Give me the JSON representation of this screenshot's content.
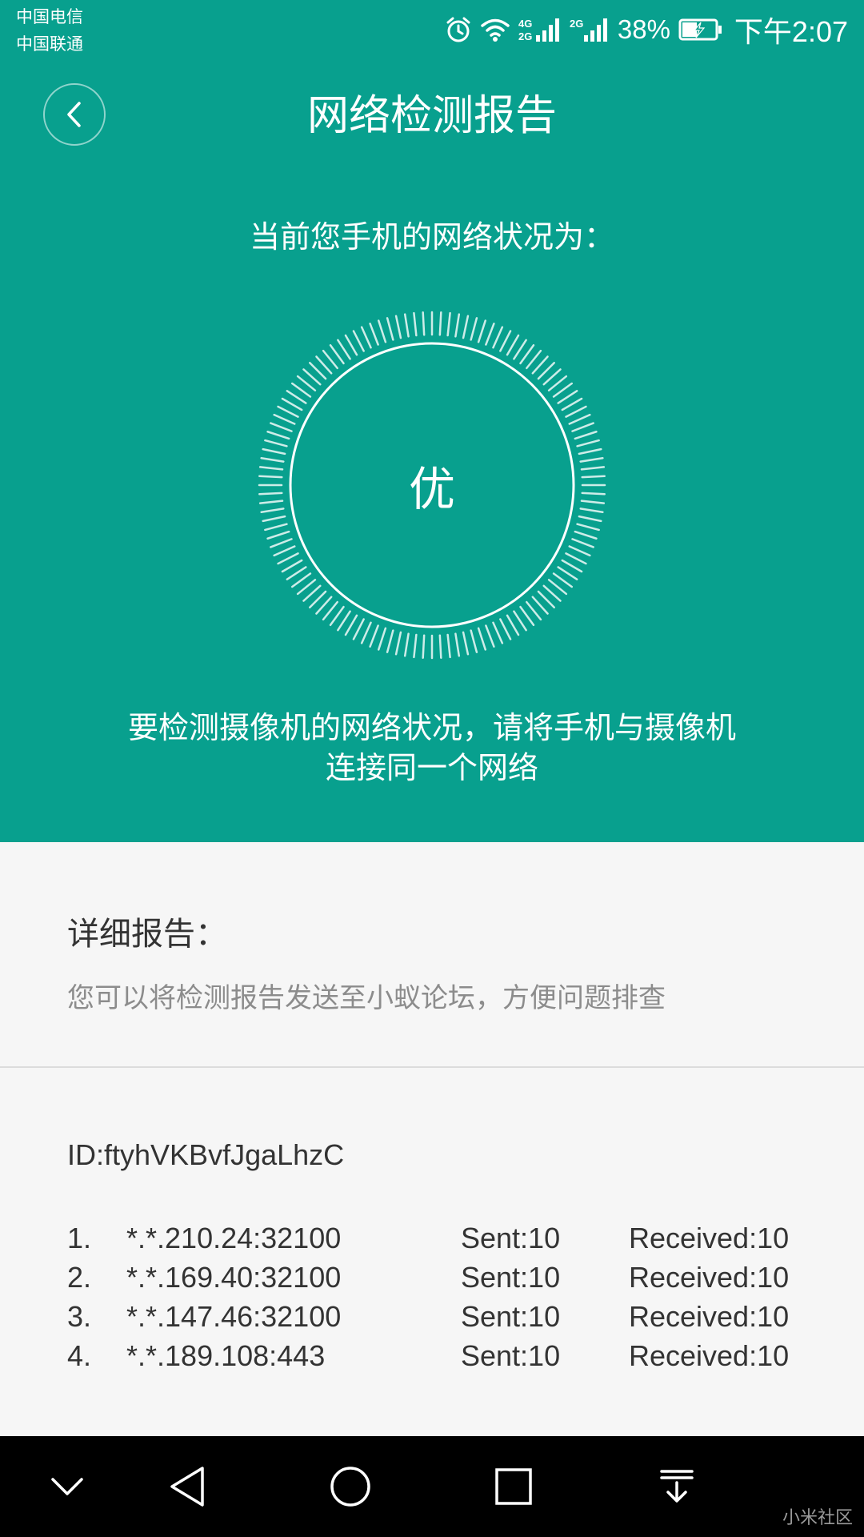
{
  "status_bar": {
    "carrier_1": "中国电信",
    "carrier_2": "中国联通",
    "net_type_1": "4G 2G",
    "net_type_2": "2G",
    "battery_percent": "38%",
    "time": "下午2:07",
    "icons": [
      "alarm-icon",
      "wifi-icon",
      "signal-icon",
      "signal-icon",
      "battery-charging-icon"
    ]
  },
  "header": {
    "back_icon": "chevron-left-icon",
    "title": "网络检测报告"
  },
  "summary": {
    "question": "当前您手机的网络状况为：",
    "grade": "优",
    "hint_line_1": "要检测摄像机的网络状况，请将手机与摄像机",
    "hint_line_2": "连接同一个网络"
  },
  "report": {
    "heading": "详细报告：",
    "description": "您可以将检测报告发送至小蚁论坛，方便问题排查",
    "device_id": "ID:ftyhVKBvfJgaLhzC",
    "servers": [
      {
        "index": "1.",
        "address": "*.*.210.24:32100",
        "sent": "Sent:10",
        "received": "Received:10"
      },
      {
        "index": "2.",
        "address": "*.*.169.40:32100",
        "sent": "Sent:10",
        "received": "Received:10"
      },
      {
        "index": "3.",
        "address": "*.*.147.46:32100",
        "sent": "Sent:10",
        "received": "Received:10"
      },
      {
        "index": "4.",
        "address": "*.*.189.108:443",
        "sent": "Sent:10",
        "received": "Received:10"
      }
    ]
  },
  "nav_bar": {
    "icons": [
      "chevron-down-icon",
      "back-triangle-icon",
      "home-circle-icon",
      "recents-square-icon",
      "notification-pull-icon"
    ]
  },
  "watermark": "小米社区",
  "colors": {
    "primary": "#08a08e",
    "background": "#f6f6f6",
    "nav_bar": "#000000"
  }
}
